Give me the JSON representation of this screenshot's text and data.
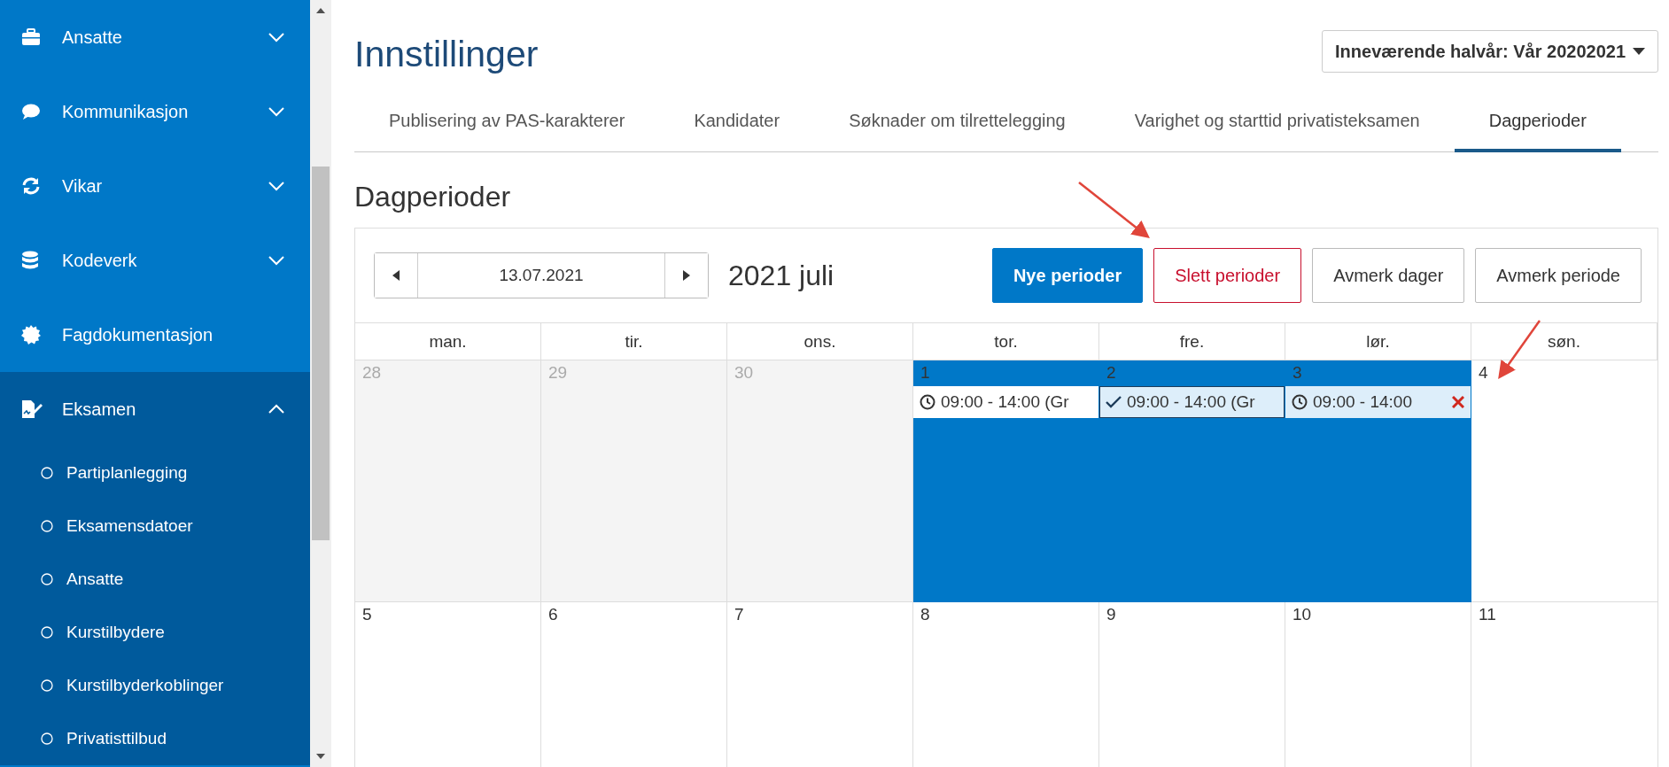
{
  "sidebar": {
    "items": [
      {
        "label": "Ansatte",
        "kind": "group",
        "expanded": false
      },
      {
        "label": "Kommunikasjon",
        "kind": "group",
        "expanded": false
      },
      {
        "label": "Vikar",
        "kind": "group",
        "expanded": false
      },
      {
        "label": "Kodeverk",
        "kind": "group",
        "expanded": false
      },
      {
        "label": "Fagdokumentasjon",
        "kind": "link"
      },
      {
        "label": "Eksamen",
        "kind": "group",
        "expanded": true,
        "children": [
          {
            "label": "Partiplanlegging"
          },
          {
            "label": "Eksamensdatoer"
          },
          {
            "label": "Ansatte"
          },
          {
            "label": "Kurstilbydere"
          },
          {
            "label": "Kurstilbyderkoblinger"
          },
          {
            "label": "Privatisttilbud"
          }
        ]
      }
    ]
  },
  "page": {
    "title": "Innstillinger",
    "term_dropdown": "Inneværende halvår: Vår 20202021",
    "tabs": [
      {
        "label": "Publisering av PAS-karakterer",
        "selected": false
      },
      {
        "label": "Kandidater",
        "selected": false
      },
      {
        "label": "Søknader om tilrettelegging",
        "selected": false
      },
      {
        "label": "Varighet og starttid privatisteksamen",
        "selected": false
      },
      {
        "label": "Dagperioder",
        "selected": true
      }
    ],
    "section_title": "Dagperioder"
  },
  "calendar": {
    "date": "13.07.2021",
    "month_label": "2021 juli",
    "buttons": [
      {
        "label": "Nye perioder",
        "kind": "primary"
      },
      {
        "label": "Slett perioder",
        "kind": "danger"
      },
      {
        "label": "Avmerk dager",
        "kind": "default"
      },
      {
        "label": "Avmerk periode",
        "kind": "default"
      }
    ],
    "weekdays": [
      "man.",
      "tir.",
      "ons.",
      "tor.",
      "fre.",
      "lør.",
      "søn."
    ],
    "weeks": [
      {
        "days": [
          {
            "day": "28",
            "outside": true,
            "selected": false
          },
          {
            "day": "29",
            "outside": true,
            "selected": false
          },
          {
            "day": "30",
            "outside": true,
            "selected": false
          },
          {
            "day": "1",
            "outside": false,
            "selected": true,
            "events": [
              {
                "text": "09:00 - 14:00 (Gr",
                "kind": "clock",
                "selected": false,
                "hovered": false
              }
            ]
          },
          {
            "day": "2",
            "outside": false,
            "selected": true,
            "events": [
              {
                "text": "09:00 - 14:00 (Gr",
                "kind": "check",
                "selected": true,
                "hovered": false
              }
            ]
          },
          {
            "day": "3",
            "outside": false,
            "selected": true,
            "events": [
              {
                "text": "09:00 - 14:00",
                "kind": "clock",
                "selected": false,
                "hovered": true
              }
            ]
          },
          {
            "day": "4",
            "outside": false,
            "selected": false
          }
        ]
      },
      {
        "days": [
          {
            "day": "5",
            "outside": false,
            "selected": false
          },
          {
            "day": "6",
            "outside": false,
            "selected": false
          },
          {
            "day": "7",
            "outside": false,
            "selected": false
          },
          {
            "day": "8",
            "outside": false,
            "selected": false
          },
          {
            "day": "9",
            "outside": false,
            "selected": false
          },
          {
            "day": "10",
            "outside": false,
            "selected": false
          },
          {
            "day": "11",
            "outside": false,
            "selected": false
          }
        ]
      }
    ]
  }
}
